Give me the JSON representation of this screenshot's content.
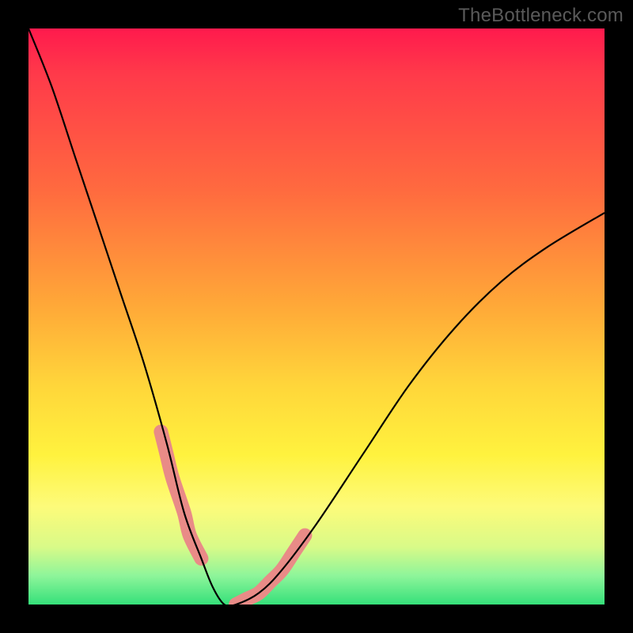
{
  "watermark": "TheBottleneck.com",
  "chart_data": {
    "type": "line",
    "title": "",
    "xlabel": "",
    "ylabel": "",
    "xlim": [
      0,
      100
    ],
    "ylim": [
      0,
      100
    ],
    "series": [
      {
        "name": "bottleneck-curve",
        "x": [
          0,
          4,
          8,
          12,
          16,
          20,
          24,
          27,
          30,
          32,
          34,
          36,
          40,
          44,
          50,
          58,
          66,
          74,
          82,
          90,
          100
        ],
        "y": [
          100,
          90,
          78,
          66,
          54,
          42,
          28,
          16,
          8,
          3,
          0,
          0,
          2,
          6,
          14,
          26,
          38,
          48,
          56,
          62,
          68
        ]
      },
      {
        "name": "highlight-band-left",
        "x": [
          23,
          24,
          25,
          27,
          28,
          30
        ],
        "y": [
          30,
          26,
          22,
          16,
          12,
          8
        ]
      },
      {
        "name": "highlight-band-right",
        "x": [
          36,
          38,
          40,
          42,
          44,
          46,
          48
        ],
        "y": [
          0,
          1,
          2,
          4,
          6,
          9,
          12
        ]
      }
    ],
    "colors": {
      "curve": "#000000",
      "highlight": "#e98b87",
      "gradient_top": "#ff1a4d",
      "gradient_bottom": "#35e07a"
    }
  }
}
